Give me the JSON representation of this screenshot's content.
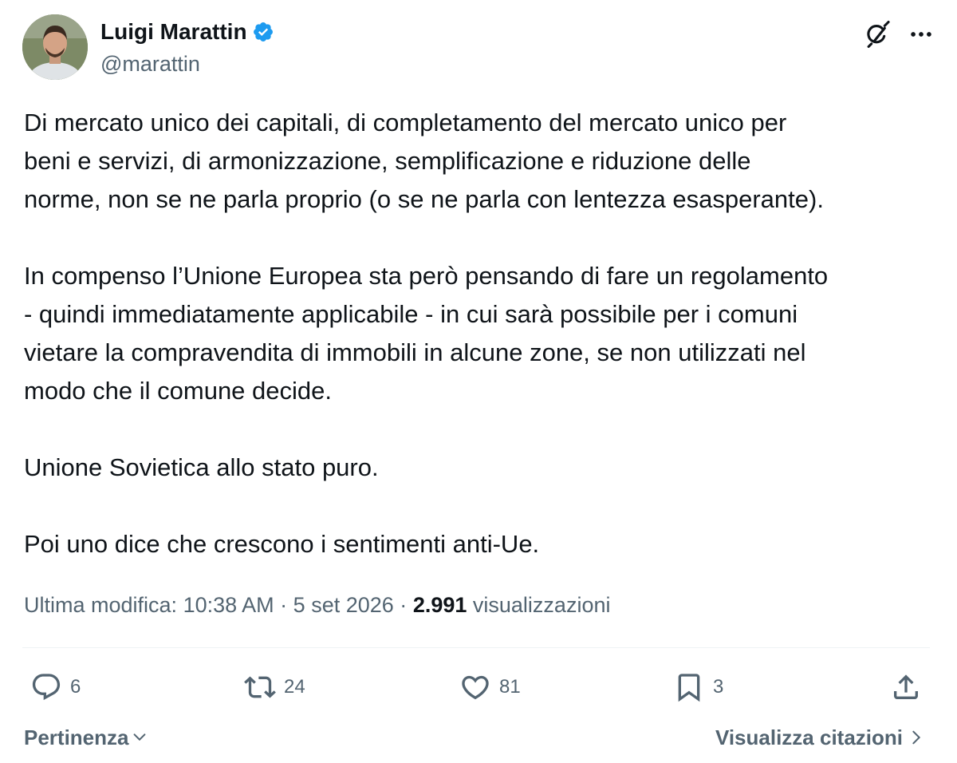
{
  "author": {
    "display_name": "Luigi Marattin",
    "handle": "@marattin",
    "verified_icon": "verified-badge-icon"
  },
  "header_actions": {
    "grok_icon": "grok-icon",
    "more_icon": "more-dots-icon"
  },
  "tweet": {
    "paragraphs": [
      "Di mercato unico dei capitali, di completamento del mercato unico per\nbeni e servizi, di armonizzazione, semplificazione e riduzione delle\nnorme, non se ne parla proprio (o se ne parla con lentezza esasperante).",
      "In compenso l’Unione Europea sta però pensando di fare un regolamento\n- quindi immediatamente applicabile - in cui sarà possibile per i comuni\nvietare la compravendita di immobili in alcune zone, se non utilizzati nel\nmodo che il comune decide.",
      "Unione Sovietica allo stato puro.",
      "Poi uno dice che crescono i sentimenti anti-Ue."
    ]
  },
  "meta": {
    "edited_label": "Ultima modifica:",
    "time": "10:38 AM",
    "sep1": "·",
    "date": "5 set 2026",
    "sep2": "·",
    "views_count": "2.991",
    "views_label": "visualizzazioni"
  },
  "actions": {
    "replies": "6",
    "reposts": "24",
    "likes": "81",
    "bookmarks": "3"
  },
  "footer": {
    "sort_label": "Pertinenza",
    "quotes_label": "Visualizza citazioni"
  },
  "colors": {
    "text": "#0f1419",
    "secondary": "#536471",
    "verified": "#1d9bf0",
    "divider": "#eff3f4"
  }
}
